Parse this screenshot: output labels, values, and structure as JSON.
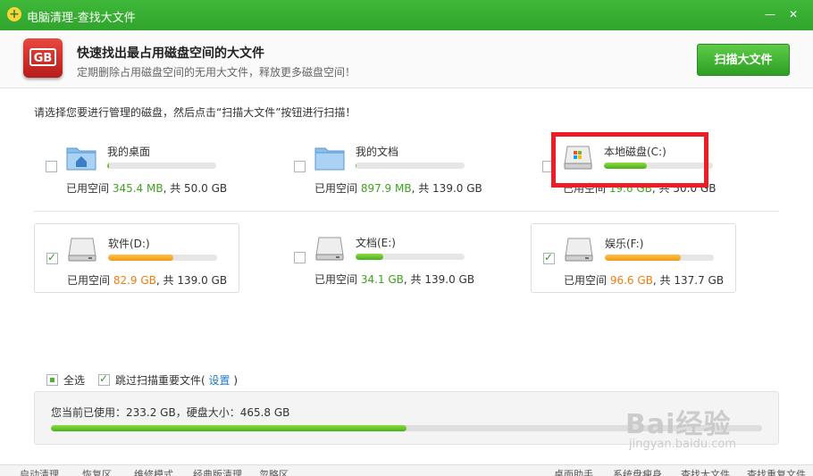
{
  "window": {
    "title": "电脑清理-查找大文件",
    "minimize": "—",
    "close": "✕"
  },
  "header": {
    "icon_text": "GB",
    "title": "快速找出最占用磁盘空间的大文件",
    "subtitle": "定期删除占用磁盘空间的无用大文件，释放更多磁盘空间！",
    "scan_button": "扫描大文件"
  },
  "instruction": "请选择您要进行管理的磁盘，然后点击“扫描大文件”按钮进行扫描！",
  "usage_prefix": "已用空间 ",
  "total_prefix": ", 共 ",
  "drives": [
    {
      "name": "我的桌面",
      "used": "345.4 MB",
      "total": "50.0 GB",
      "checked": false,
      "fill": 0.02,
      "color": "green",
      "icon": "desktop-folder-icon"
    },
    {
      "name": "我的文档",
      "used": "897.9 MB",
      "total": "139.0 GB",
      "checked": false,
      "fill": 0.01,
      "color": "green",
      "icon": "documents-folder-icon"
    },
    {
      "name": "本地磁盘(C:)",
      "used": "19.6 GB",
      "total": "50.0 GB",
      "checked": false,
      "fill": 0.39,
      "color": "green",
      "icon": "windows-disk-icon"
    },
    {
      "name": "软件(D:)",
      "used": "82.9 GB",
      "total": "139.0 GB",
      "checked": true,
      "fill": 0.6,
      "color": "orange",
      "icon": "hard-disk-icon"
    },
    {
      "name": "文档(E:)",
      "used": "34.1 GB",
      "total": "139.0 GB",
      "checked": false,
      "fill": 0.25,
      "color": "green",
      "icon": "hard-disk-icon"
    },
    {
      "name": "娱乐(F:)",
      "used": "96.6 GB",
      "total": "137.7 GB",
      "checked": true,
      "fill": 0.7,
      "color": "orange",
      "icon": "hard-disk-icon"
    }
  ],
  "options": {
    "select_all": "全选",
    "skip_important": "跳过扫描重要文件(",
    "settings_link": "设置",
    "close_paren": " )"
  },
  "summary": {
    "text": "您当前已使用：233.2 GB，硬盘大小：465.8 GB",
    "fill": 0.5
  },
  "footer": {
    "left": [
      "启动清理",
      "恢复区",
      "维修模式",
      "经典版清理",
      "忽略区"
    ],
    "right": [
      "桌面助手",
      "系统盘瘦身",
      "查找大文件",
      "查找重复文件"
    ]
  },
  "watermark": {
    "brand": "Bai经验",
    "url": "jingyan.baidu.com"
  },
  "colors": {
    "accent": "#2fa52b",
    "used_green": "#3da51e",
    "used_orange": "#f07c0c",
    "highlight": "#ee1c25"
  }
}
